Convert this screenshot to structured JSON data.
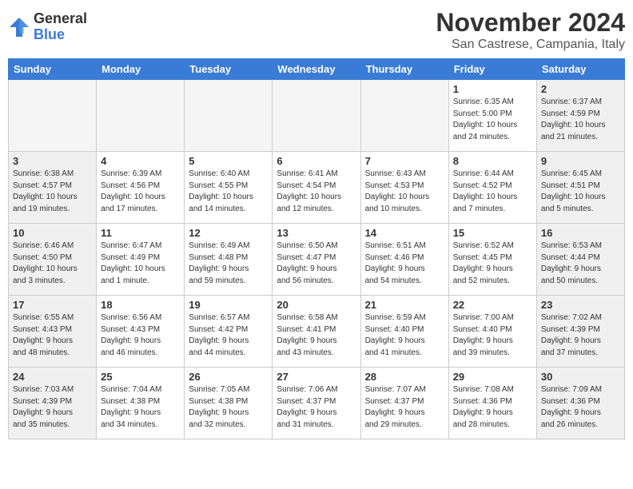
{
  "logo": {
    "general": "General",
    "blue": "Blue"
  },
  "title": "November 2024",
  "location": "San Castrese, Campania, Italy",
  "headers": [
    "Sunday",
    "Monday",
    "Tuesday",
    "Wednesday",
    "Thursday",
    "Friday",
    "Saturday"
  ],
  "weeks": [
    [
      {
        "day": "",
        "info": ""
      },
      {
        "day": "",
        "info": ""
      },
      {
        "day": "",
        "info": ""
      },
      {
        "day": "",
        "info": ""
      },
      {
        "day": "",
        "info": ""
      },
      {
        "day": "1",
        "info": "Sunrise: 6:35 AM\nSunset: 5:00 PM\nDaylight: 10 hours\nand 24 minutes."
      },
      {
        "day": "2",
        "info": "Sunrise: 6:37 AM\nSunset: 4:59 PM\nDaylight: 10 hours\nand 21 minutes."
      }
    ],
    [
      {
        "day": "3",
        "info": "Sunrise: 6:38 AM\nSunset: 4:57 PM\nDaylight: 10 hours\nand 19 minutes."
      },
      {
        "day": "4",
        "info": "Sunrise: 6:39 AM\nSunset: 4:56 PM\nDaylight: 10 hours\nand 17 minutes."
      },
      {
        "day": "5",
        "info": "Sunrise: 6:40 AM\nSunset: 4:55 PM\nDaylight: 10 hours\nand 14 minutes."
      },
      {
        "day": "6",
        "info": "Sunrise: 6:41 AM\nSunset: 4:54 PM\nDaylight: 10 hours\nand 12 minutes."
      },
      {
        "day": "7",
        "info": "Sunrise: 6:43 AM\nSunset: 4:53 PM\nDaylight: 10 hours\nand 10 minutes."
      },
      {
        "day": "8",
        "info": "Sunrise: 6:44 AM\nSunset: 4:52 PM\nDaylight: 10 hours\nand 7 minutes."
      },
      {
        "day": "9",
        "info": "Sunrise: 6:45 AM\nSunset: 4:51 PM\nDaylight: 10 hours\nand 5 minutes."
      }
    ],
    [
      {
        "day": "10",
        "info": "Sunrise: 6:46 AM\nSunset: 4:50 PM\nDaylight: 10 hours\nand 3 minutes."
      },
      {
        "day": "11",
        "info": "Sunrise: 6:47 AM\nSunset: 4:49 PM\nDaylight: 10 hours\nand 1 minute."
      },
      {
        "day": "12",
        "info": "Sunrise: 6:49 AM\nSunset: 4:48 PM\nDaylight: 9 hours\nand 59 minutes."
      },
      {
        "day": "13",
        "info": "Sunrise: 6:50 AM\nSunset: 4:47 PM\nDaylight: 9 hours\nand 56 minutes."
      },
      {
        "day": "14",
        "info": "Sunrise: 6:51 AM\nSunset: 4:46 PM\nDaylight: 9 hours\nand 54 minutes."
      },
      {
        "day": "15",
        "info": "Sunrise: 6:52 AM\nSunset: 4:45 PM\nDaylight: 9 hours\nand 52 minutes."
      },
      {
        "day": "16",
        "info": "Sunrise: 6:53 AM\nSunset: 4:44 PM\nDaylight: 9 hours\nand 50 minutes."
      }
    ],
    [
      {
        "day": "17",
        "info": "Sunrise: 6:55 AM\nSunset: 4:43 PM\nDaylight: 9 hours\nand 48 minutes."
      },
      {
        "day": "18",
        "info": "Sunrise: 6:56 AM\nSunset: 4:43 PM\nDaylight: 9 hours\nand 46 minutes."
      },
      {
        "day": "19",
        "info": "Sunrise: 6:57 AM\nSunset: 4:42 PM\nDaylight: 9 hours\nand 44 minutes."
      },
      {
        "day": "20",
        "info": "Sunrise: 6:58 AM\nSunset: 4:41 PM\nDaylight: 9 hours\nand 43 minutes."
      },
      {
        "day": "21",
        "info": "Sunrise: 6:59 AM\nSunset: 4:40 PM\nDaylight: 9 hours\nand 41 minutes."
      },
      {
        "day": "22",
        "info": "Sunrise: 7:00 AM\nSunset: 4:40 PM\nDaylight: 9 hours\nand 39 minutes."
      },
      {
        "day": "23",
        "info": "Sunrise: 7:02 AM\nSunset: 4:39 PM\nDaylight: 9 hours\nand 37 minutes."
      }
    ],
    [
      {
        "day": "24",
        "info": "Sunrise: 7:03 AM\nSunset: 4:39 PM\nDaylight: 9 hours\nand 35 minutes."
      },
      {
        "day": "25",
        "info": "Sunrise: 7:04 AM\nSunset: 4:38 PM\nDaylight: 9 hours\nand 34 minutes."
      },
      {
        "day": "26",
        "info": "Sunrise: 7:05 AM\nSunset: 4:38 PM\nDaylight: 9 hours\nand 32 minutes."
      },
      {
        "day": "27",
        "info": "Sunrise: 7:06 AM\nSunset: 4:37 PM\nDaylight: 9 hours\nand 31 minutes."
      },
      {
        "day": "28",
        "info": "Sunrise: 7:07 AM\nSunset: 4:37 PM\nDaylight: 9 hours\nand 29 minutes."
      },
      {
        "day": "29",
        "info": "Sunrise: 7:08 AM\nSunset: 4:36 PM\nDaylight: 9 hours\nand 28 minutes."
      },
      {
        "day": "30",
        "info": "Sunrise: 7:09 AM\nSunset: 4:36 PM\nDaylight: 9 hours\nand 26 minutes."
      }
    ]
  ]
}
